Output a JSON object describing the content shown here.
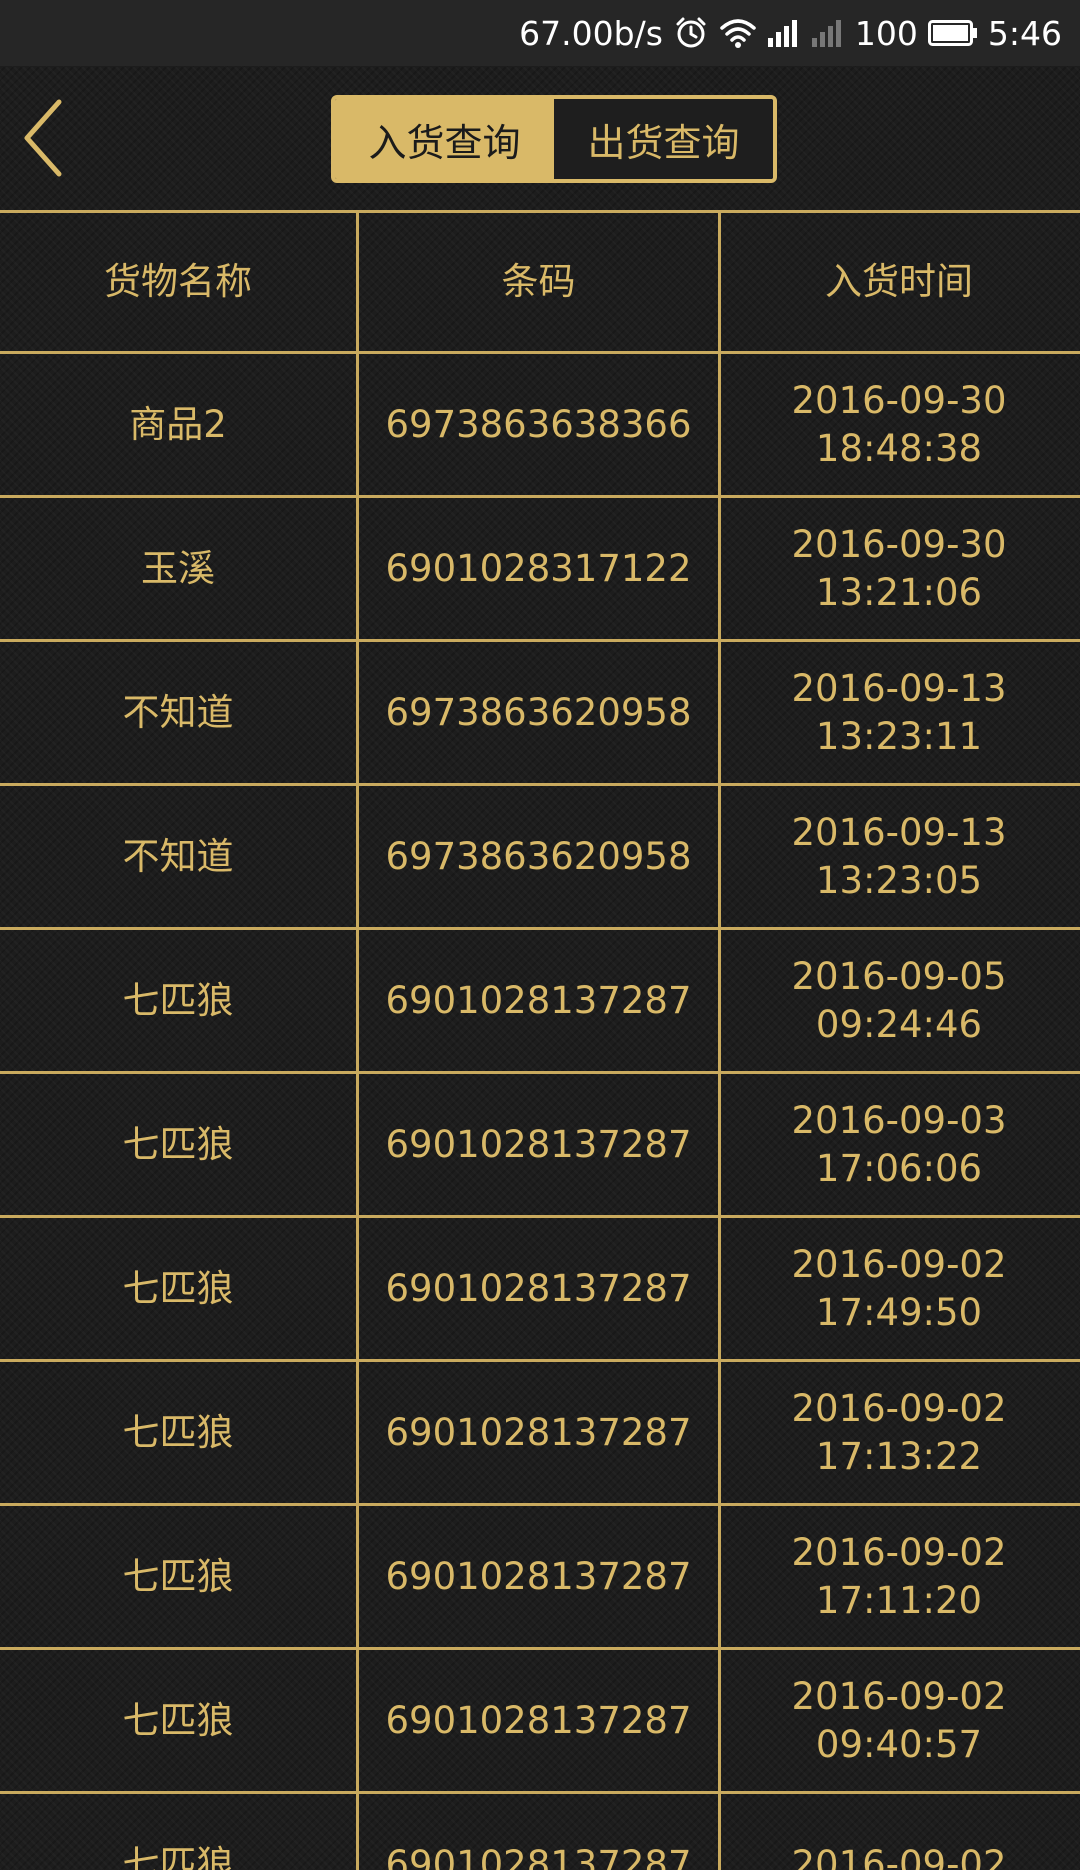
{
  "status_bar": {
    "speed": "67.00b/s",
    "battery": "100",
    "time": "5:46"
  },
  "tabs": [
    {
      "label": "入货查询",
      "active": true
    },
    {
      "label": "出货查询",
      "active": false
    }
  ],
  "table": {
    "headers": [
      "货物名称",
      "条码",
      "入货时间"
    ],
    "rows": [
      {
        "name": "商品2",
        "barcode": "6973863638366",
        "date": "2016-09-30",
        "time": "18:48:38"
      },
      {
        "name": "玉溪",
        "barcode": "6901028317122",
        "date": "2016-09-30",
        "time": "13:21:06"
      },
      {
        "name": "不知道",
        "barcode": "6973863620958",
        "date": "2016-09-13",
        "time": "13:23:11"
      },
      {
        "name": "不知道",
        "barcode": "6973863620958",
        "date": "2016-09-13",
        "time": "13:23:05"
      },
      {
        "name": "七匹狼",
        "barcode": "6901028137287",
        "date": "2016-09-05",
        "time": "09:24:46"
      },
      {
        "name": "七匹狼",
        "barcode": "6901028137287",
        "date": "2016-09-03",
        "time": "17:06:06"
      },
      {
        "name": "七匹狼",
        "barcode": "6901028137287",
        "date": "2016-09-02",
        "time": "17:49:50"
      },
      {
        "name": "七匹狼",
        "barcode": "6901028137287",
        "date": "2016-09-02",
        "time": "17:13:22"
      },
      {
        "name": "七匹狼",
        "barcode": "6901028137287",
        "date": "2016-09-02",
        "time": "17:11:20"
      },
      {
        "name": "七匹狼",
        "barcode": "6901028137287",
        "date": "2016-09-02",
        "time": "09:40:57"
      },
      {
        "name": "七匹狼",
        "barcode": "6901028137287",
        "date": "2016-09-02",
        "time": ""
      }
    ]
  },
  "icons": {
    "back": "chevron-left-icon",
    "alarm": "alarm-icon",
    "wifi": "wifi-icon",
    "signal_1": "signal-icon",
    "signal_2": "signal-empty-icon",
    "battery": "battery-icon"
  },
  "colors": {
    "gold": "#d9b968",
    "background": "#1d1d1d",
    "status_bar": "#262626"
  }
}
